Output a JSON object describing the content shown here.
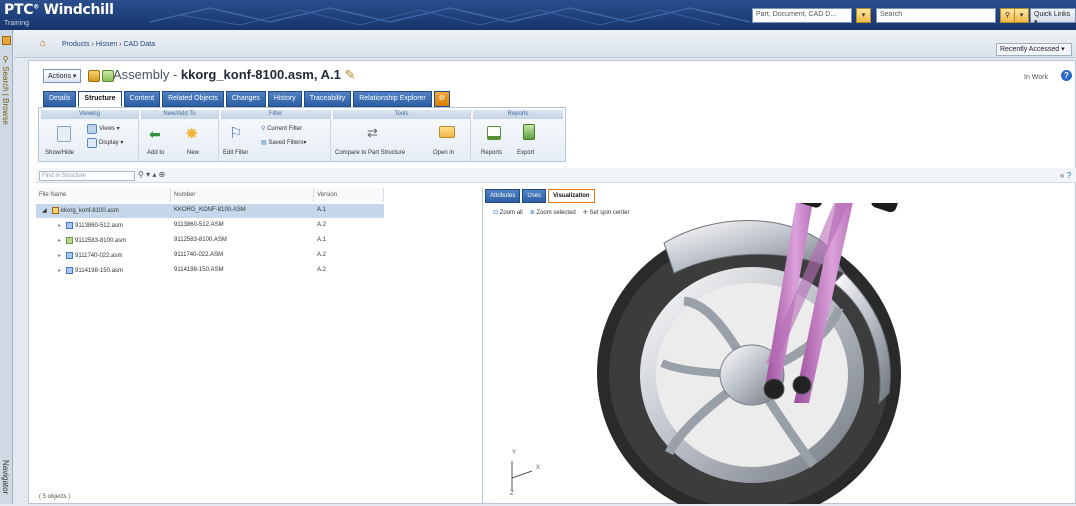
{
  "header": {
    "logo": "PTC",
    "logo_mark": "®",
    "app": "Windchill",
    "subtitle": "Training",
    "search_type": "Part, Document, CAD D...",
    "search_placeholder": "Search",
    "quick_links": "Quick Links ▾",
    "dropdown_glyph": "▾",
    "search_glyph": "⚲"
  },
  "nav": {
    "left_top": "Search | Browse",
    "left_bottom": "Navigator"
  },
  "breadcrumb": {
    "home_glyph": "⌂",
    "text": "Products › Hissen › CAD Data",
    "recent": "Recently Accessed ▾"
  },
  "object": {
    "actions": "Actions ▾",
    "title_prefix": "Assembly - ",
    "title_name": "kkorg_konf-8100.asm, A.1",
    "state": "In Work",
    "help": "?"
  },
  "tabs": [
    "Details",
    "Structure",
    "Content",
    "Related Objects",
    "Changes",
    "History",
    "Traceability",
    "Relationship Explorer"
  ],
  "ribbon": {
    "groups": [
      "Viewing",
      "New/Add To",
      "Filter",
      "Tools",
      "Reports"
    ],
    "viewing": {
      "show_hide": "Show/Hide",
      "views": "Views ▾",
      "display": "Display ▾"
    },
    "new_add": {
      "add_to": "Add to",
      "new": "New"
    },
    "filter": {
      "edit_filter": "Edit Filter",
      "current_filter": "Current Filter",
      "saved_filters": "Saved Filters▾"
    },
    "tools": {
      "compare": "Compare to Part Structure",
      "open_in": "Open in"
    },
    "reports": {
      "reports": "Reports",
      "export": "Export"
    }
  },
  "find": {
    "placeholder": "Find in Structure"
  },
  "tree": {
    "headers": [
      "File Name",
      "Number",
      "Version"
    ],
    "rows": [
      {
        "name": "kkorg_konf-8100.asm",
        "number": "KKORG_KONF-8100.ASM",
        "version": "A.1"
      },
      {
        "name": "9113860-512.asm",
        "number": "9113860-512.ASM",
        "version": "A.2"
      },
      {
        "name": "9112583-8100.asm",
        "number": "9112583-8100.ASM",
        "version": "A.1"
      },
      {
        "name": "9111740-022.asm",
        "number": "9111740-022.ASM",
        "version": "A.2"
      },
      {
        "name": "9114198-150.asm",
        "number": "9114198-150.ASM",
        "version": "A.2"
      }
    ],
    "status": "( 5 objects )"
  },
  "viewer": {
    "tabs": [
      "Attributes",
      "Uses",
      "Visualization"
    ],
    "tools": [
      "Zoom all",
      "Zoom selected",
      "Set spin center"
    ],
    "axes": {
      "y": "Y",
      "x": "X",
      "z": "Z"
    }
  },
  "colors": {
    "header": "#1f4380",
    "tab": "#3a6bb0",
    "frame": "#c77dc4",
    "tire": "#2b2b2b",
    "chrome": "#d9dde2"
  }
}
